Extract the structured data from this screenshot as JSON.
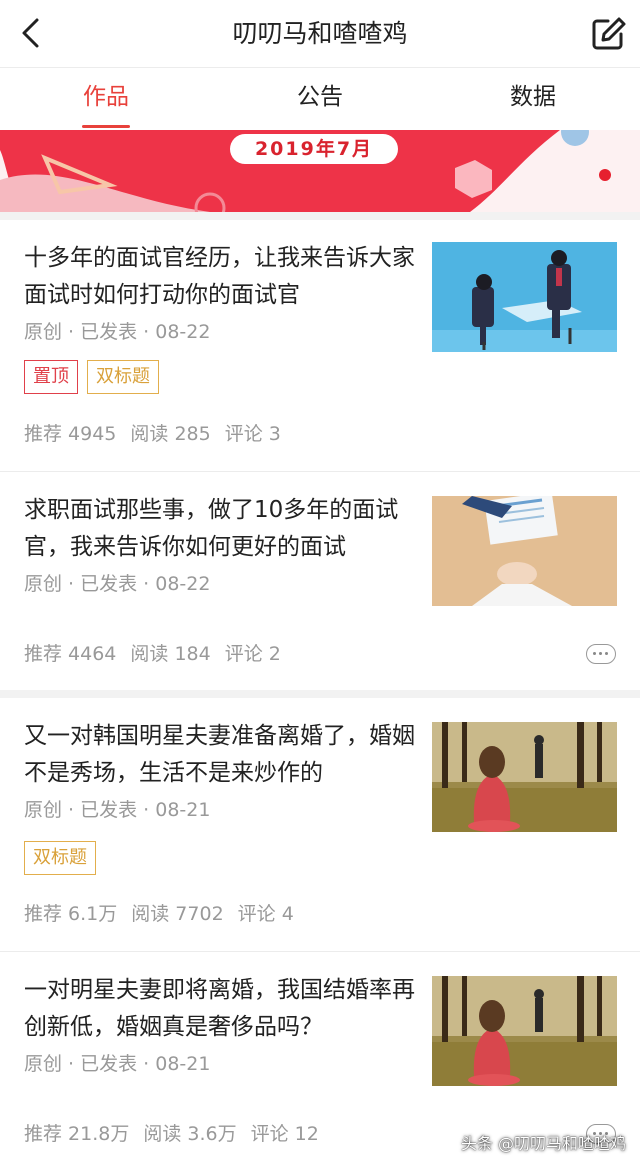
{
  "header": {
    "title": "叨叨马和喳喳鸡",
    "back_icon": "chevron-left-icon",
    "edit_icon": "edit-icon"
  },
  "tabs": [
    {
      "label": "作品",
      "active": true
    },
    {
      "label": "公告",
      "active": false
    },
    {
      "label": "数据",
      "active": false
    }
  ],
  "banner": {
    "text": "2019年7月"
  },
  "articles": [
    {
      "title": "十多年的面试官经历，让我来告诉大家面试时如何打动你的面试官",
      "meta": "原创 · 已发表 · 08-22",
      "tags": [
        "置顶",
        "双标题"
      ],
      "stats": {
        "recommend": "推荐 4945",
        "read": "阅读 285",
        "comment": "评论 3"
      }
    },
    {
      "title": "求职面试那些事，做了10多年的面试官，我来告诉你如何更好的面试",
      "meta": "原创 · 已发表 · 08-22",
      "tags": [],
      "stats": {
        "recommend": "推荐 4464",
        "read": "阅读 184",
        "comment": "评论 2"
      }
    },
    {
      "title": "又一对韩国明星夫妻准备离婚了，婚姻不是秀场，生活不是来炒作的",
      "meta": "原创 · 已发表 · 08-21",
      "tags": [
        "双标题"
      ],
      "stats": {
        "recommend": "推荐 6.1万",
        "read": "阅读 7702",
        "comment": "评论 4"
      }
    },
    {
      "title": "一对明星夫妻即将离婚，我国结婚率再创新低，婚姻真是奢侈品吗？",
      "meta": "原创 · 已发表 · 08-21",
      "tags": [],
      "stats": {
        "recommend": "推荐 21.8万",
        "read": "阅读 3.6万",
        "comment": "评论 12"
      }
    }
  ],
  "watermark": "头条 @叨叨马和喳喳鸡",
  "colors": {
    "accent": "#e8413b",
    "tag_red": "#e0404a",
    "tag_gold": "#d9a13a",
    "meta_gray": "#999999"
  }
}
